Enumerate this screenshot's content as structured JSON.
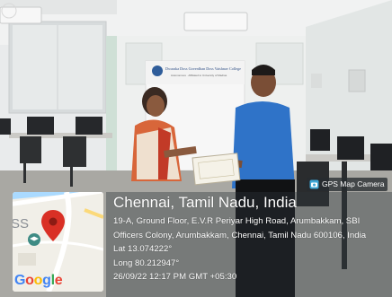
{
  "photo": {
    "banner_title": "Dwaraka Doss Goverdhan Doss Vaishnav College",
    "banner_subtitle": "Autonomous · Affiliated to University of Madras"
  },
  "badge": {
    "label": "GPS Map Camera",
    "icon": "camera-icon"
  },
  "location": {
    "city": "Chennai, Tamil Nadu, India",
    "address_line1": "19-A, Ground Floor, E.V.R Periyar High Road, Arumbakkam, SBI",
    "address_line2": "Officers Colony, Arumbakkam, Chennai, Tamil Nadu 600106, India",
    "lat": "Lat 13.074222°",
    "long": "Long 80.212947°",
    "datetime": "26/09/22 12:17 PM GMT +05:30"
  },
  "map": {
    "edge_text": "SS",
    "brand": "Google",
    "pin_color": "#d93025",
    "water_color": "#aadaff",
    "road_color": "#ffffff"
  }
}
